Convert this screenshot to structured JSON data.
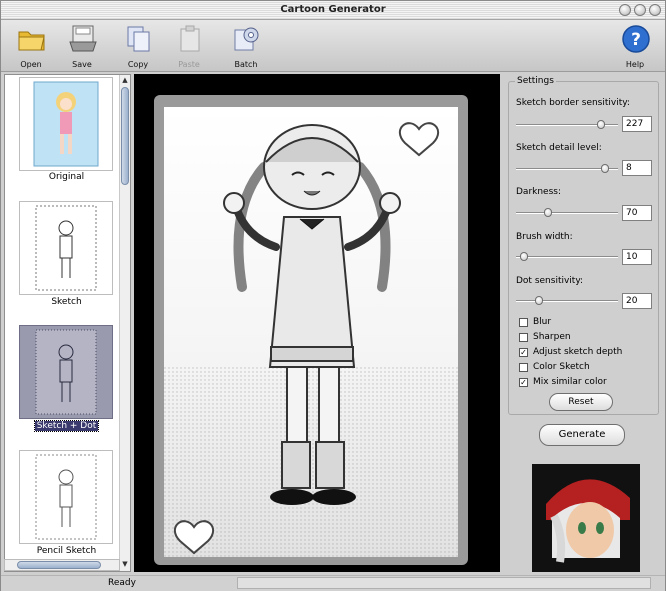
{
  "window": {
    "title": "Cartoon Generator"
  },
  "toolbar": {
    "open": "Open",
    "save": "Save",
    "copy": "Copy",
    "paste": "Paste",
    "batch": "Batch",
    "help": "Help"
  },
  "thumbnails": [
    {
      "label": "Original",
      "selected": false
    },
    {
      "label": "Sketch",
      "selected": false
    },
    {
      "label": "Sketch + Dot",
      "selected": true
    },
    {
      "label": "Pencil Sketch",
      "selected": false
    }
  ],
  "settings": {
    "title": "Settings",
    "sliders": [
      {
        "label": "Sketch border sensitivity:",
        "value": "227",
        "level": 0.86
      },
      {
        "label": "Sketch detail level:",
        "value": "8",
        "level": 0.9
      },
      {
        "label": "Darkness:",
        "value": "70",
        "level": 0.3
      },
      {
        "label": "Brush width:",
        "value": "10",
        "level": 0.04
      },
      {
        "label": "Dot sensitivity:",
        "value": "20",
        "level": 0.2
      }
    ],
    "checkboxes": [
      {
        "label": "Blur",
        "checked": false
      },
      {
        "label": "Sharpen",
        "checked": false
      },
      {
        "label": "Adjust sketch depth",
        "checked": true
      },
      {
        "label": "Color Sketch",
        "checked": false
      },
      {
        "label": "Mix similar color",
        "checked": true
      }
    ],
    "reset": "Reset",
    "generate": "Generate"
  },
  "status": {
    "text": "Ready"
  },
  "colors": {
    "help_blue": "#2f6fd0",
    "selected_thumb": "#9a9aae"
  }
}
